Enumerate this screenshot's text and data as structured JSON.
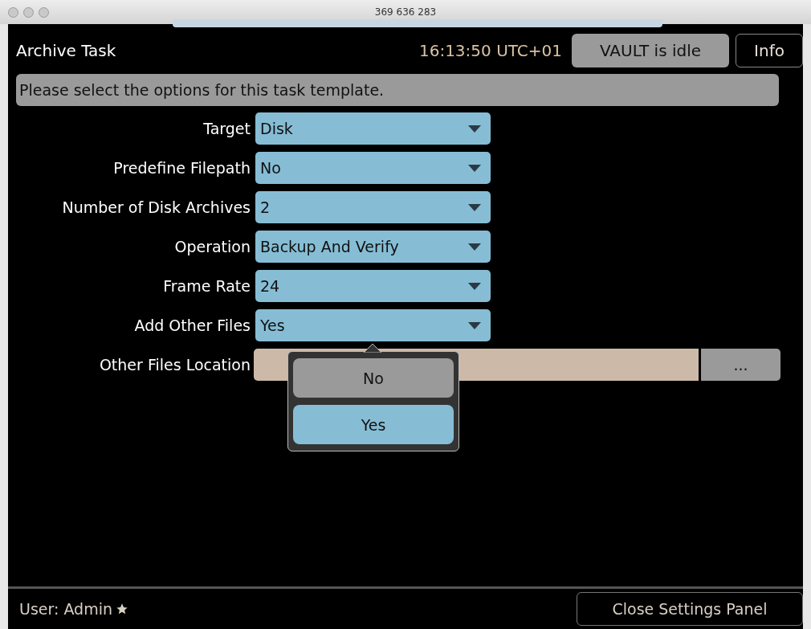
{
  "window": {
    "title": "369 636 283"
  },
  "header": {
    "title": "Archive Task",
    "time": "16:13:50 UTC+01",
    "status": "VAULT is idle",
    "info_button": "Info"
  },
  "prompt": "Please select the options for this task template.",
  "options": [
    {
      "label": "Target",
      "value": "Disk"
    },
    {
      "label": "Predefine Filepath",
      "value": "No"
    },
    {
      "label": "Number of Disk Archives",
      "value": "2"
    },
    {
      "label": "Operation",
      "value": "Backup And Verify"
    },
    {
      "label": "Frame Rate",
      "value": "24"
    },
    {
      "label": "Add Other Files",
      "value": "Yes"
    }
  ],
  "location": {
    "label": "Other Files Location",
    "browse_button": "..."
  },
  "popup": {
    "items": [
      {
        "label": "No",
        "selected": false
      },
      {
        "label": "Yes",
        "selected": true
      }
    ]
  },
  "footer": {
    "user": "User: Admin",
    "close_button": "Close Settings Panel"
  }
}
